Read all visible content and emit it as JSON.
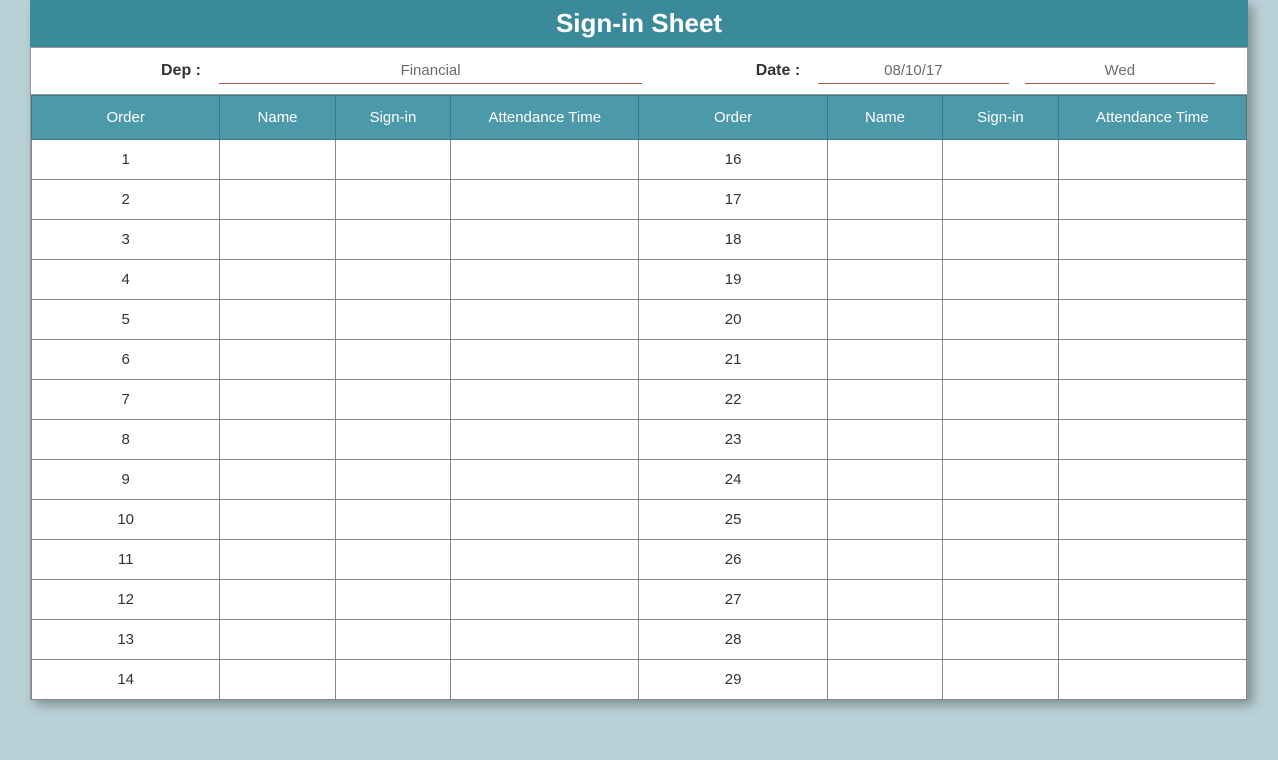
{
  "title": "Sign-in Sheet",
  "info": {
    "dep_label": "Dep :",
    "dep_value": "Financial",
    "date_label": "Date :",
    "date_value": "08/10/17",
    "day_value": "Wed"
  },
  "headers": {
    "order": "Order",
    "name": "Name",
    "signin": "Sign-in",
    "attendance": "Attendance Time"
  },
  "rows_left": [
    "1",
    "2",
    "3",
    "4",
    "5",
    "6",
    "7",
    "8",
    "9",
    "10",
    "11",
    "12",
    "13",
    "14"
  ],
  "rows_right": [
    "16",
    "17",
    "18",
    "19",
    "20",
    "21",
    "22",
    "23",
    "24",
    "25",
    "26",
    "27",
    "28",
    "29"
  ]
}
